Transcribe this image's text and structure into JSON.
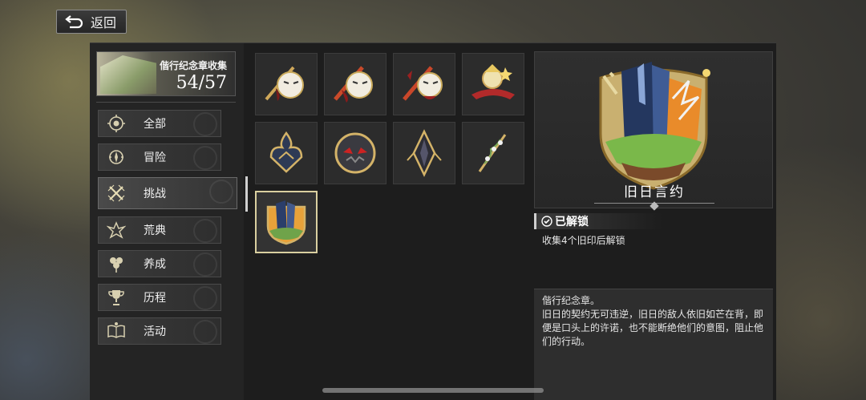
{
  "header": {
    "back_label": "返回"
  },
  "collection": {
    "title": "偕行纪念章收集",
    "count": "54/57"
  },
  "sidebar": {
    "items": [
      {
        "label": "全部",
        "icon": "medal-icon"
      },
      {
        "label": "冒险",
        "icon": "compass-medal-icon"
      },
      {
        "label": "挑战",
        "icon": "crossed-swords-icon"
      },
      {
        "label": "荒典",
        "icon": "monster-claw-icon"
      },
      {
        "label": "养成",
        "icon": "flower-growth-icon"
      },
      {
        "label": "历程",
        "icon": "trophy-icon"
      },
      {
        "label": "活动",
        "icon": "open-book-icon"
      }
    ],
    "active_index": 2
  },
  "badges": [
    {
      "icon": "masked-knight-badge-icon"
    },
    {
      "icon": "masked-knight-red-badge-icon"
    },
    {
      "icon": "masked-knight-dark-badge-icon"
    },
    {
      "icon": "golden-hero-badge-icon"
    },
    {
      "icon": "flame-crest-badge-icon"
    },
    {
      "icon": "beast-face-badge-icon"
    },
    {
      "icon": "dark-spire-badge-icon"
    },
    {
      "icon": "vine-sword-badge-icon"
    },
    {
      "icon": "old-oath-badge-icon"
    }
  ],
  "selected_index": 8,
  "detail": {
    "name": "旧日言约",
    "status": "已解锁",
    "condition": "收集4个旧印后解锁",
    "desc_title": "偕行纪念章。",
    "desc_body": "旧日的契约无可违逆，旧日的敌人依旧如芒在背，即便是口头上的许诺，也不能断绝他们的意图，阻止他们的行动。"
  },
  "colors": {
    "panel_bg": "#1d1d1d",
    "accent_gold": "#d9cfa0",
    "text": "#e8e8e8"
  }
}
